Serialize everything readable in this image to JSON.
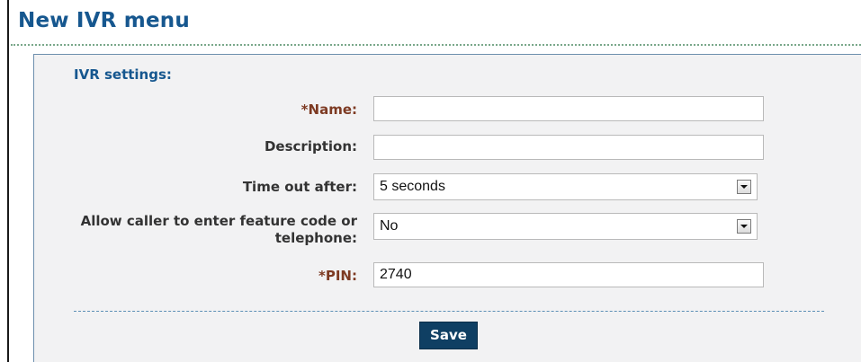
{
  "page": {
    "title": "New IVR menu"
  },
  "ivr_settings": {
    "section_title": "IVR settings:",
    "name": {
      "label": "*Name:",
      "value": ""
    },
    "description": {
      "label": "Description:",
      "value": ""
    },
    "timeout": {
      "label": "Time out after:",
      "selected": "5 seconds"
    },
    "allow_feature_code": {
      "label_line1": "Allow caller to enter feature code or",
      "label_line2": "telephone:",
      "selected": "No"
    },
    "pin": {
      "label": "*PIN:",
      "value": "2740"
    }
  },
  "actions": {
    "save_label": "Save"
  },
  "colors": {
    "title": "#16578f",
    "required_label": "#7d3a22",
    "button": "#0f3f63",
    "panel": "#f2f2f3"
  },
  "icons": {
    "select_arrow": "chevron-down-icon"
  }
}
